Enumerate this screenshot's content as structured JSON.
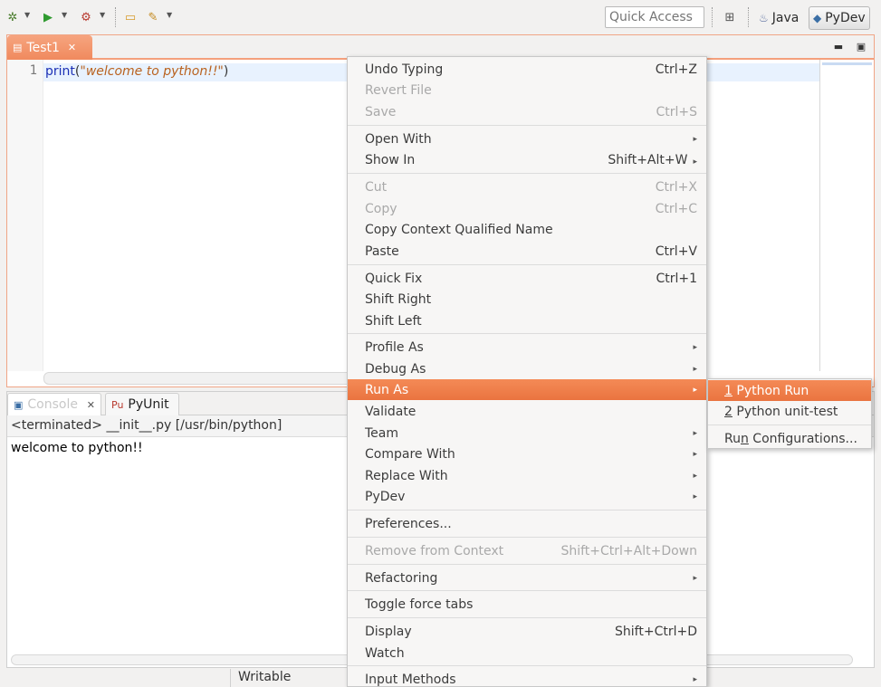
{
  "toolbar": {
    "quick_access_placeholder": "Quick Access",
    "perspectives": [
      {
        "label": "Java",
        "icon": "java-perspective-icon"
      },
      {
        "label": "PyDev",
        "icon": "python-icon",
        "active": true
      }
    ]
  },
  "editor": {
    "tab_label": "Test1",
    "line_number": "1",
    "code": {
      "func": "print",
      "open": "(",
      "string": "\"welcome to python!!\"",
      "close": ")"
    }
  },
  "console": {
    "tabs": [
      {
        "label": "Console"
      },
      {
        "label": "PyUnit"
      }
    ],
    "status": "<terminated> __init__.py [/usr/bin/python]",
    "output": "welcome to python!!"
  },
  "statusbar": {
    "writable": "Writable"
  },
  "context_menu": {
    "items": [
      {
        "label": "Undo Typing",
        "shortcut": "Ctrl+Z"
      },
      {
        "label": "Revert File",
        "disabled": true
      },
      {
        "label": "Save",
        "shortcut": "Ctrl+S",
        "disabled": true
      },
      {
        "label": "Open With",
        "submenu": true
      },
      {
        "label": "Show In",
        "shortcut": "Shift+Alt+W",
        "submenu": true
      },
      {
        "label": "Cut",
        "shortcut": "Ctrl+X",
        "disabled": true
      },
      {
        "label": "Copy",
        "shortcut": "Ctrl+C",
        "disabled": true
      },
      {
        "label": "Copy Context Qualified Name"
      },
      {
        "label": "Paste",
        "shortcut": "Ctrl+V"
      },
      {
        "label": "Quick Fix",
        "shortcut": "Ctrl+1"
      },
      {
        "label": "Shift Right"
      },
      {
        "label": "Shift Left"
      },
      {
        "label": "Profile As",
        "submenu": true
      },
      {
        "label": "Debug As",
        "submenu": true
      },
      {
        "label": "Run As",
        "submenu": true,
        "highlighted": true
      },
      {
        "label": "Validate"
      },
      {
        "label": "Team",
        "submenu": true
      },
      {
        "label": "Compare With",
        "submenu": true
      },
      {
        "label": "Replace With",
        "submenu": true
      },
      {
        "label": "PyDev",
        "submenu": true
      },
      {
        "label": "Preferences..."
      },
      {
        "label": "Remove from Context",
        "shortcut": "Shift+Ctrl+Alt+Down",
        "disabled": true
      },
      {
        "label": "Refactoring",
        "submenu": true
      },
      {
        "label": "Toggle force tabs"
      },
      {
        "label": "Display",
        "shortcut": "Shift+Ctrl+D"
      },
      {
        "label": "Watch"
      },
      {
        "label": "Input Methods",
        "submenu": true
      }
    ]
  },
  "submenu": {
    "items": [
      {
        "mnemonic": "1",
        "label": " Python Run",
        "highlighted": true
      },
      {
        "mnemonic": "2",
        "label": " Python unit-test"
      },
      {
        "pre": "Ru",
        "mnemonic": "n",
        "label": " Configurations..."
      }
    ]
  },
  "colors": {
    "accent": "#ef7f4d",
    "highlight": "#ee7c48"
  }
}
